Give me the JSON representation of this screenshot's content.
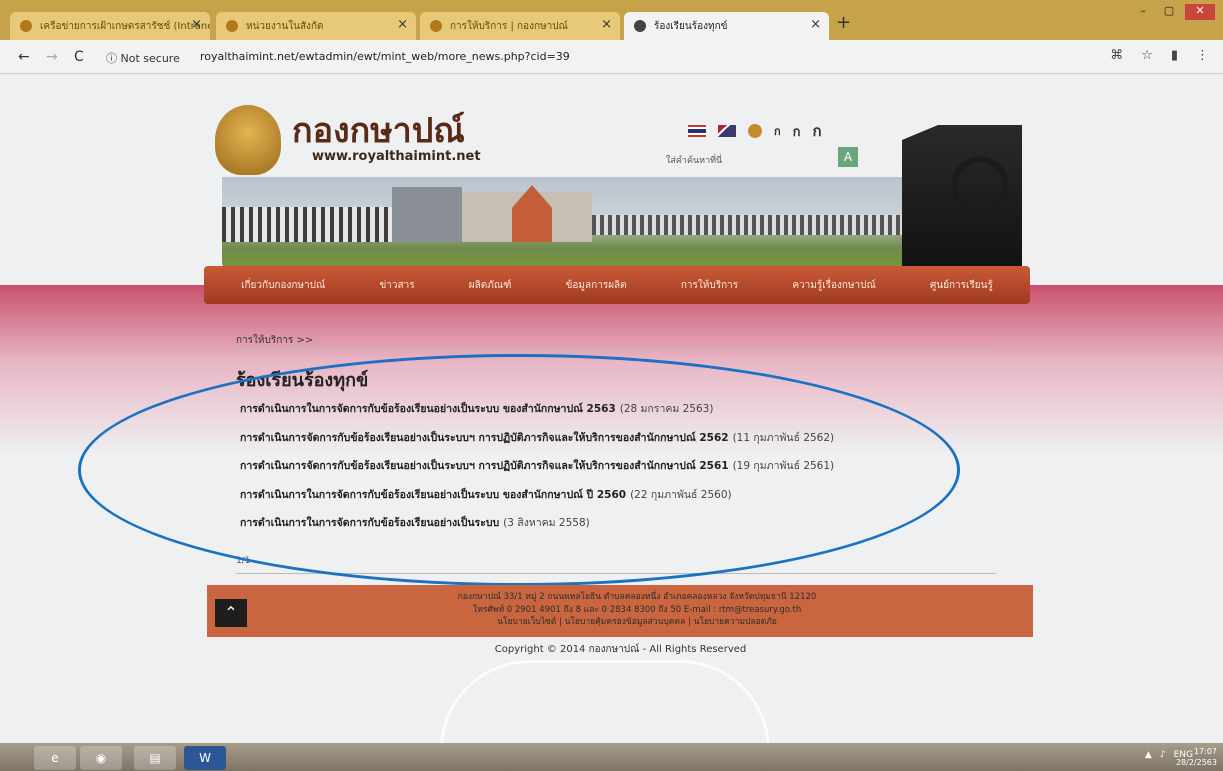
{
  "browser": {
    "tabs": [
      {
        "label": "เครือข่ายการเฝ้าเกษตรสารัชช์ (Intranet)",
        "active": false
      },
      {
        "label": "หน่วยงานในสังกัด",
        "active": false
      },
      {
        "label": "การให้บริการ | กองกษาปณ์",
        "active": false
      },
      {
        "label": "ร้องเรียนร้องทุกข์",
        "active": true
      }
    ],
    "new_tab": "+",
    "window_controls": {
      "minimize": "–",
      "maximize": "▢",
      "close": "✕"
    },
    "security": "Not secure",
    "url": "royalthaimint.net/ewtadmin/ewt/mint_web/more_news.php?cid=39"
  },
  "site": {
    "title": "กองกษาปณ์",
    "url": "www.royalthaimint.net",
    "font_sizes": [
      "ก",
      "ก",
      "ก"
    ],
    "search_label": "ใส่คำค้นหาที่นี่",
    "search_button": "A"
  },
  "menu": [
    "เกี่ยวกับกองกษาปณ์",
    "ข่าวสาร",
    "ผลิตภัณฑ์",
    "ข้อมูลการผลิต",
    "การให้บริการ",
    "ความรู้เรื่องกษาปณ์",
    "ศูนย์การเรียนรู้"
  ],
  "content": {
    "breadcrumb": "การให้บริการ >>",
    "title": "ร้องเรียนร้องทุกข์",
    "news": [
      {
        "title": "การดำเนินการในการจัดการกับข้อร้องเรียนอย่างเป็นระบบ ของสำนักกษาปณ์ 2563",
        "date": "(28 มกราคม 2563)"
      },
      {
        "title": "การดำเนินการจัดการกับข้อร้องเรียนอย่างเป็นระบบฯ การปฏิบัติภารกิจและให้บริการของสำนักกษาปณ์ 2562",
        "date": "(11 กุมภาพันธ์ 2562)"
      },
      {
        "title": "การดำเนินการจัดการกับข้อร้องเรียนอย่างเป็นระบบฯ การปฏิบัติภารกิจและให้บริการของสำนักกษาปณ์ 2561",
        "date": "(19 กุมภาพันธ์ 2561)"
      },
      {
        "title": "การดำเนินการในการจัดการกับข้อร้องเรียนอย่างเป็นระบบ ของสำนักกษาปณ์ ปี 2560",
        "date": "(22 กุมภาพันธ์ 2560)"
      },
      {
        "title": "การดำเนินการในการจัดการกับข้อร้องเรียนอย่างเป็นระบบ",
        "date": "(3 สิงหาคม 2558)"
      }
    ],
    "pager": "1/1"
  },
  "footer": {
    "address": "กองกษาปณ์ 33/1 หมู่ 2 ถนนพหลโยธิน ตำบลคลองหนึ่ง อำเภอคลองหลวง จังหวัดปทุมธานี 12120",
    "phone": "โทรศัพท์ 0 2901 4901 ถึง 8 และ 0 2834 8300 ถึง 50 E-mail : rtm@treasury.go.th",
    "links": "นโยบายเว็บไซต์ | นโยบายคุ้มครองข้อมูลส่วนบุคคล | นโยบายความปลอดภัย",
    "copyright": "Copyright © 2014 กองกษาปณ์ - All Rights Reserved"
  },
  "taskbar": {
    "apps": [
      "e",
      "◉",
      "▤",
      "W"
    ],
    "tray": [
      "ENG"
    ],
    "time": "17:07",
    "date": "28/2/2563"
  },
  "colors": {
    "menu": "#b4472a",
    "footer": "#c9653f",
    "highlight_ellipse": "#1b72c0"
  }
}
